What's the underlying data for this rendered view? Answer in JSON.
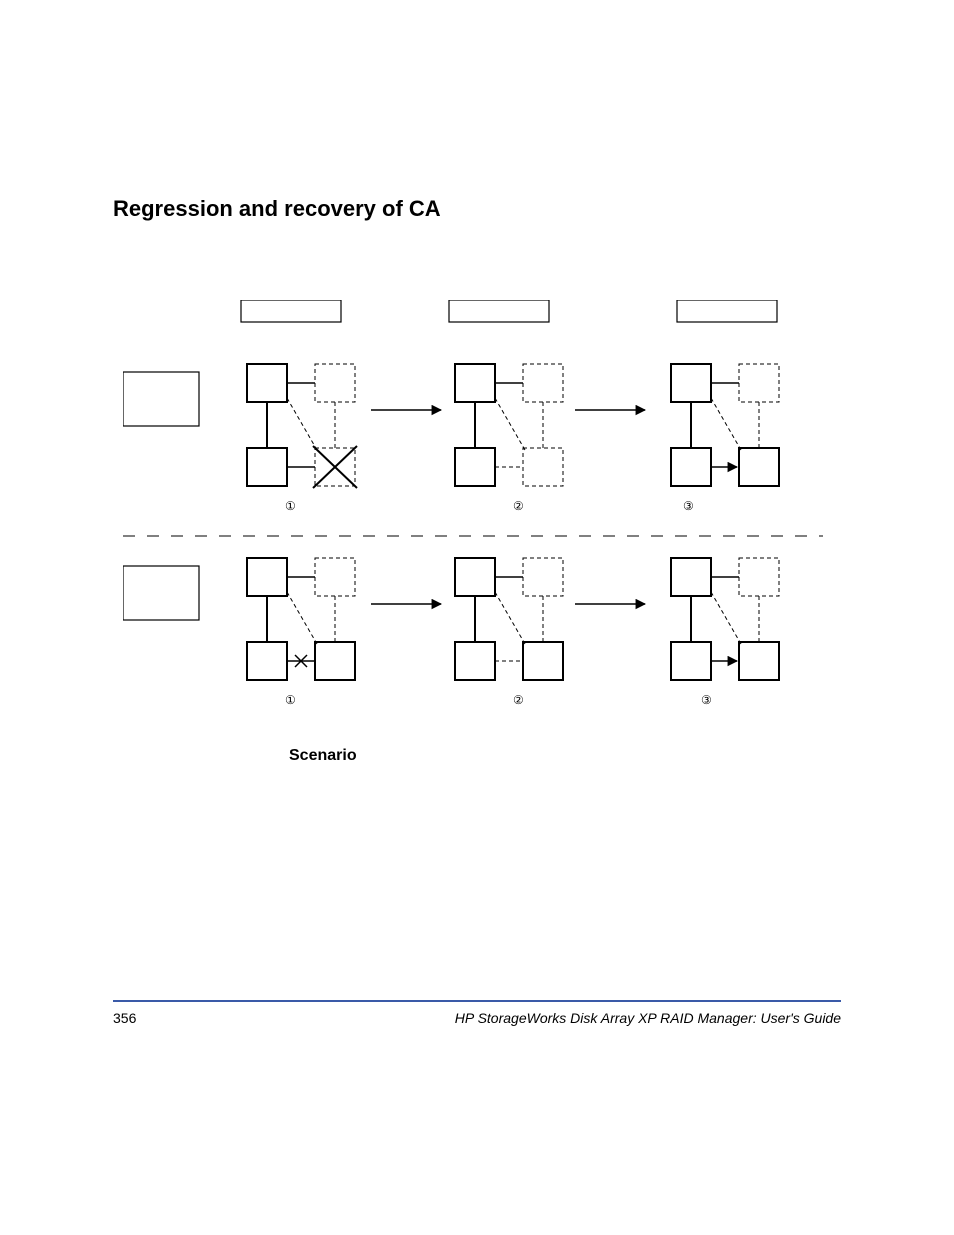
{
  "heading": "Regression and recovery of CA",
  "scenario_label": "Scenario",
  "page_number": "356",
  "footer_title": "HP StorageWorks Disk Array XP RAID Manager: User's Guide",
  "step1": "①",
  "step2": "②",
  "step3": "③"
}
